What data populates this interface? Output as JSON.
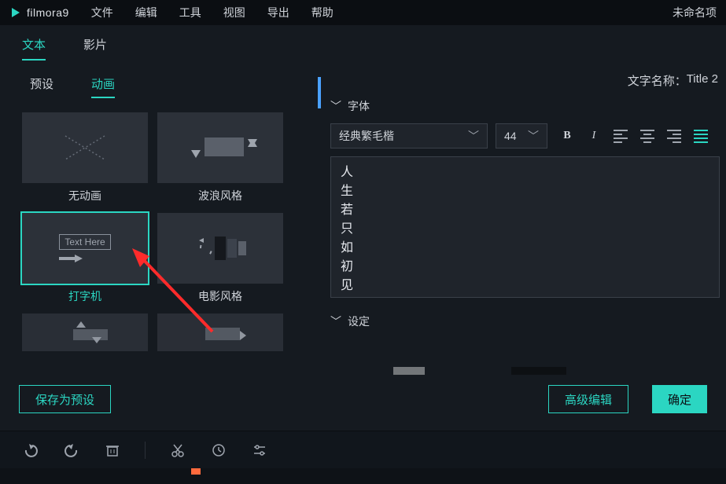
{
  "app": {
    "name": "filmora9",
    "project_title": "未命名项"
  },
  "menu": [
    "文件",
    "编辑",
    "工具",
    "视图",
    "导出",
    "帮助"
  ],
  "mode_tabs": {
    "items": [
      "文本",
      "影片"
    ],
    "active": 0
  },
  "left_tabs": {
    "items": [
      "预设",
      "动画"
    ],
    "active": 1
  },
  "animations": [
    {
      "id": "no-anim",
      "label": "无动画"
    },
    {
      "id": "wave",
      "label": "波浪风格"
    },
    {
      "id": "typewriter",
      "label": "打字机",
      "selected": true,
      "placeholder": "Text Here"
    },
    {
      "id": "cinema",
      "label": "电影风格"
    }
  ],
  "text_name": {
    "label": "文字名称：",
    "value": "Title 2"
  },
  "font_section": {
    "heading": "字体",
    "font_family": "经典繁毛楷",
    "font_size": "44",
    "bold": "B",
    "italic": "I"
  },
  "text_content": "人\n生\n若\n只\n如\n初\n见",
  "settings_section": {
    "heading": "设定"
  },
  "buttons": {
    "save_preset": "保存为预设",
    "advanced": "高级编辑",
    "ok": "确定"
  },
  "toolbar_icons": [
    "undo-icon",
    "redo-icon",
    "delete-icon",
    "cut-icon",
    "clock-icon",
    "adjust-icon"
  ]
}
